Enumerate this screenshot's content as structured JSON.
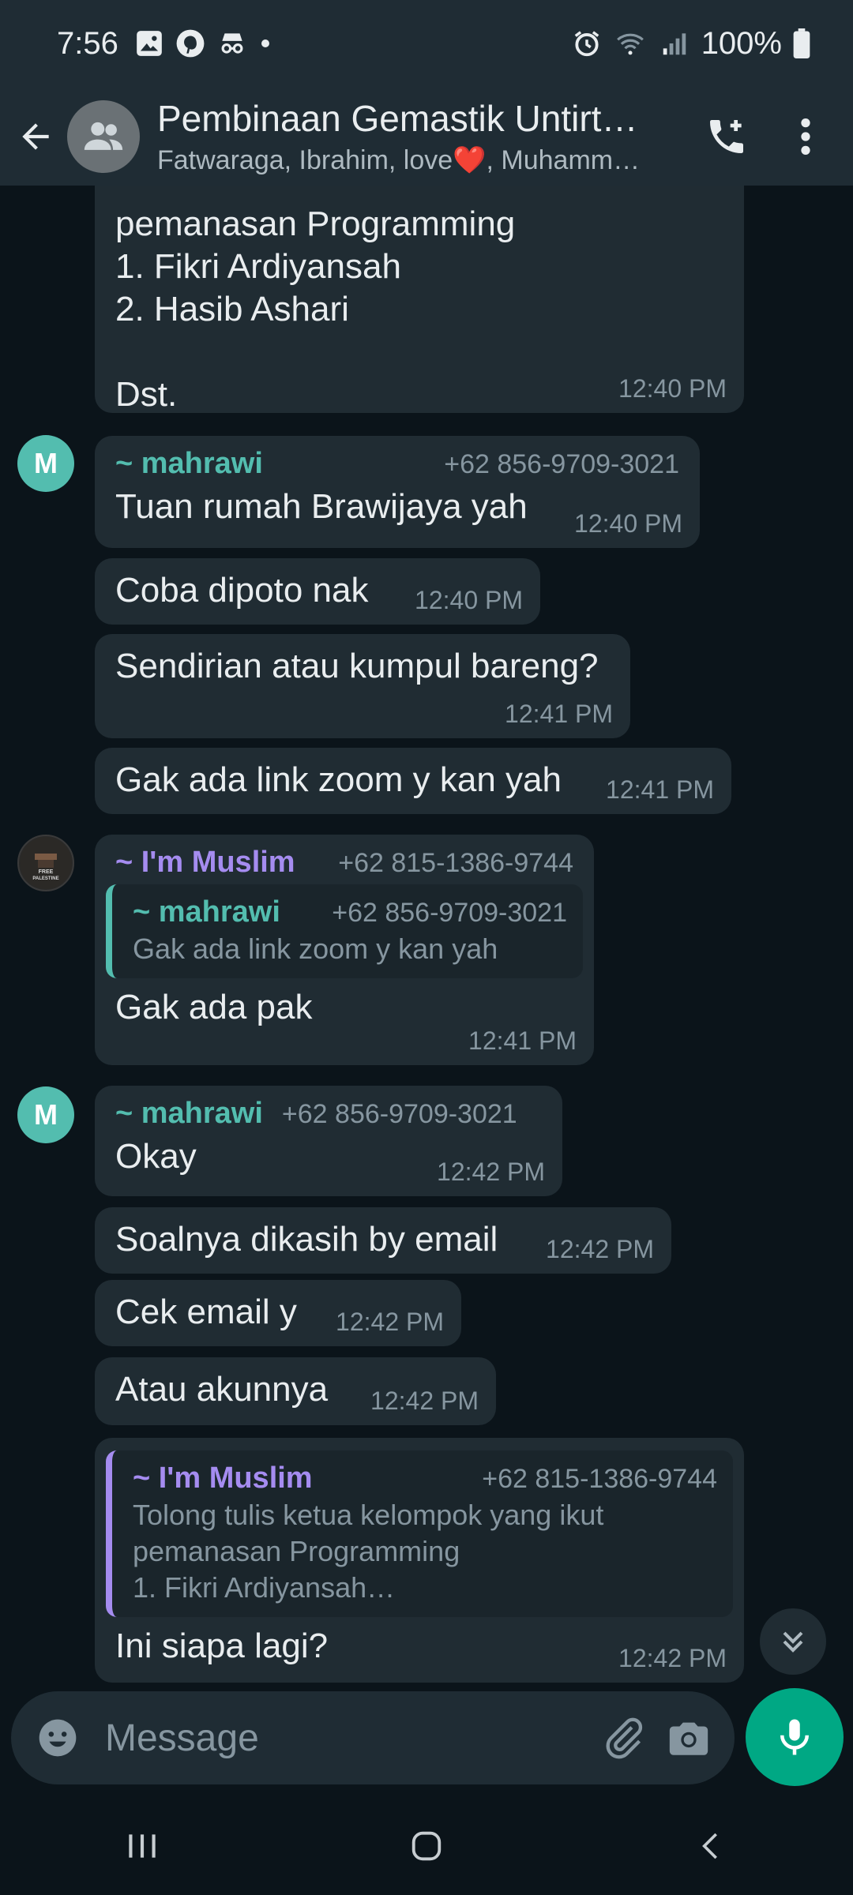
{
  "status_bar": {
    "time": "7:56",
    "battery": "100%",
    "left_icons": [
      "gallery-icon",
      "pinterest-icon",
      "incognito-icon",
      "dot-icon"
    ],
    "right_icons": [
      "alarm-icon",
      "wifi-icon",
      "signal-icon",
      "battery-icon"
    ]
  },
  "header": {
    "title": "Pembinaan Gemastik Untirt…",
    "subtitle": "Fatwaraga, Ibrahim, love❤️, Muhamm…"
  },
  "colors": {
    "mahrawi": "#53bdaf",
    "muslim": "#a58cf0",
    "accent": "#00a884",
    "bubble": "#202c33",
    "background": "#0b141a"
  },
  "messages": [
    {
      "text": "pemanasan Programming\n1. Fikri Ardiyansah\n2. Hasib Ashari\n\nDst.",
      "time": "12:40 PM"
    },
    {
      "sender": "~ mahrawi",
      "phone": "+62 856-9709-3021",
      "avatar": "M",
      "text": "Tuan rumah Brawijaya yah",
      "time": "12:40 PM"
    },
    {
      "text": "Coba dipoto nak",
      "time": "12:40 PM"
    },
    {
      "text": "Sendirian atau kumpul bareng?",
      "time": "12:41 PM"
    },
    {
      "text": "Gak ada link zoom y kan yah",
      "time": "12:41 PM"
    },
    {
      "sender": "~ I'm Muslim",
      "phone": "+62 815-1386-9744",
      "avatar_text": "FREE PALESTINE",
      "quote": {
        "sender": "~ mahrawi",
        "phone": "+62 856-9709-3021",
        "text": "Gak ada link zoom y kan yah"
      },
      "text": "Gak ada pak",
      "time": "12:41 PM"
    },
    {
      "sender": "~ mahrawi",
      "phone": "+62 856-9709-3021",
      "avatar": "M",
      "text": "Okay",
      "time": "12:42 PM"
    },
    {
      "text": "Soalnya dikasih by email",
      "time": "12:42 PM"
    },
    {
      "text": "Cek email y",
      "time": "12:42 PM"
    },
    {
      "text": "Atau akunnya",
      "time": "12:42 PM"
    },
    {
      "quote": {
        "sender": "~ I'm Muslim",
        "phone": "+62 815-1386-9744",
        "text": "Tolong tulis ketua kelompok yang ikut\npemanasan Programming\n1. Fikri Ardiyansah…"
      },
      "text": "Ini siapa lagi?",
      "time": "12:42 PM"
    }
  ],
  "input": {
    "placeholder": "Message"
  }
}
